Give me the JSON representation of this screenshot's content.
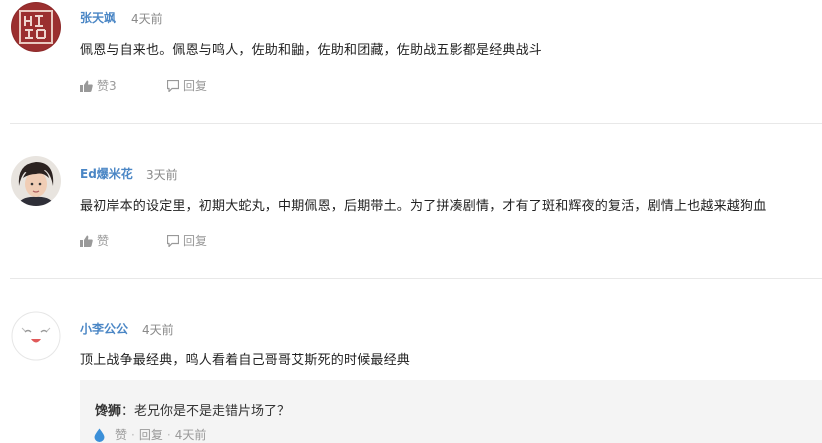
{
  "comments": [
    {
      "username": "张天飒",
      "time": "4天前",
      "text": "佩恩与自来也。佩恩与鸣人，佐助和鼬，佐助和团藏，佐助战五影都是经典战斗",
      "like_label": "赞3",
      "reply_label": "回复",
      "avatar": "seal-stamp-avatar"
    },
    {
      "username": "Ed爆米花",
      "time": "3天前",
      "text": "最初岸本的设定里，初期大蛇丸，中期佩恩，后期带土。为了拼凑剧情，才有了斑和辉夜的复活，剧情上也越来越狗血",
      "like_label": "赞",
      "reply_label": "回复",
      "avatar": "person-photo-avatar"
    },
    {
      "username": "小李公公",
      "time": "4天前",
      "text": "顶上战争最经典，鸣人看着自己哥哥艾斯死的时候最经典",
      "avatar": "default-face-avatar",
      "reply": {
        "author": "馋狮",
        "separator": "：",
        "text": "老兄你是不是走错片场了？",
        "like_label": "赞",
        "dot1": "·",
        "reply_label": "回复",
        "dot2": "·",
        "time": "4天前"
      }
    }
  ],
  "colors": {
    "username": "#4a86c5",
    "meta": "#999999",
    "reply_bg": "#f4f4f4",
    "water_drop": "#3b8fd8"
  }
}
